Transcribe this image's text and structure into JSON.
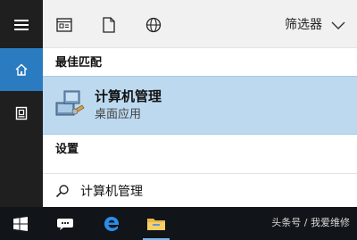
{
  "rail": {
    "items": [
      {
        "icon": "hamburger-menu-icon"
      },
      {
        "icon": "home-icon",
        "active": true
      },
      {
        "icon": "notebook-icon"
      }
    ]
  },
  "filter_bar": {
    "icons": [
      "apps-icon",
      "documents-icon",
      "web-globe-icon"
    ],
    "filter_label": "筛选器"
  },
  "sections": {
    "best_match": "最佳匹配",
    "settings": "设置"
  },
  "result": {
    "title": "计算机管理",
    "subtitle": "桌面应用",
    "icon": "computer-management-icon"
  },
  "search": {
    "value": "计算机管理"
  },
  "taskbar": {
    "items": [
      "windows-start-icon",
      "cortana-icon",
      "edge-icon",
      "file-explorer-icon"
    ],
    "watermark": "头条号 / 我爱维修"
  },
  "colors": {
    "rail_bg": "#1f1f1f",
    "active_blue": "#2b7bc0",
    "result_highlight": "#bcd9ef",
    "taskbar_bg": "#111418"
  }
}
